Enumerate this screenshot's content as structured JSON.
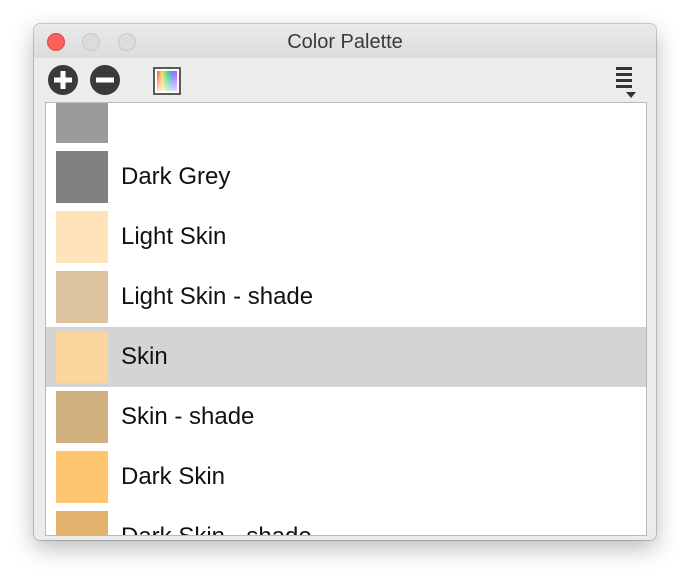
{
  "window": {
    "title": "Color Palette"
  },
  "toolbar": {
    "add_icon": "plus-circle-icon",
    "remove_icon": "minus-circle-icon",
    "colors_icon": "color-picker-icon",
    "menu_icon": "list-menu-icon"
  },
  "palette": {
    "items": [
      {
        "label": "",
        "color": "#9b9b9b"
      },
      {
        "label": "Dark Grey",
        "color": "#808080"
      },
      {
        "label": "Light Skin",
        "color": "#ffe3bb"
      },
      {
        "label": "Light Skin - shade",
        "color": "#dcc4a1"
      },
      {
        "label": "Skin",
        "color": "#fad59d",
        "selected": true
      },
      {
        "label": "Skin - shade",
        "color": "#cfaf80"
      },
      {
        "label": "Dark Skin",
        "color": "#ffc672"
      },
      {
        "label": "Dark Skin - shade",
        "color": "#e1b26c"
      }
    ]
  }
}
